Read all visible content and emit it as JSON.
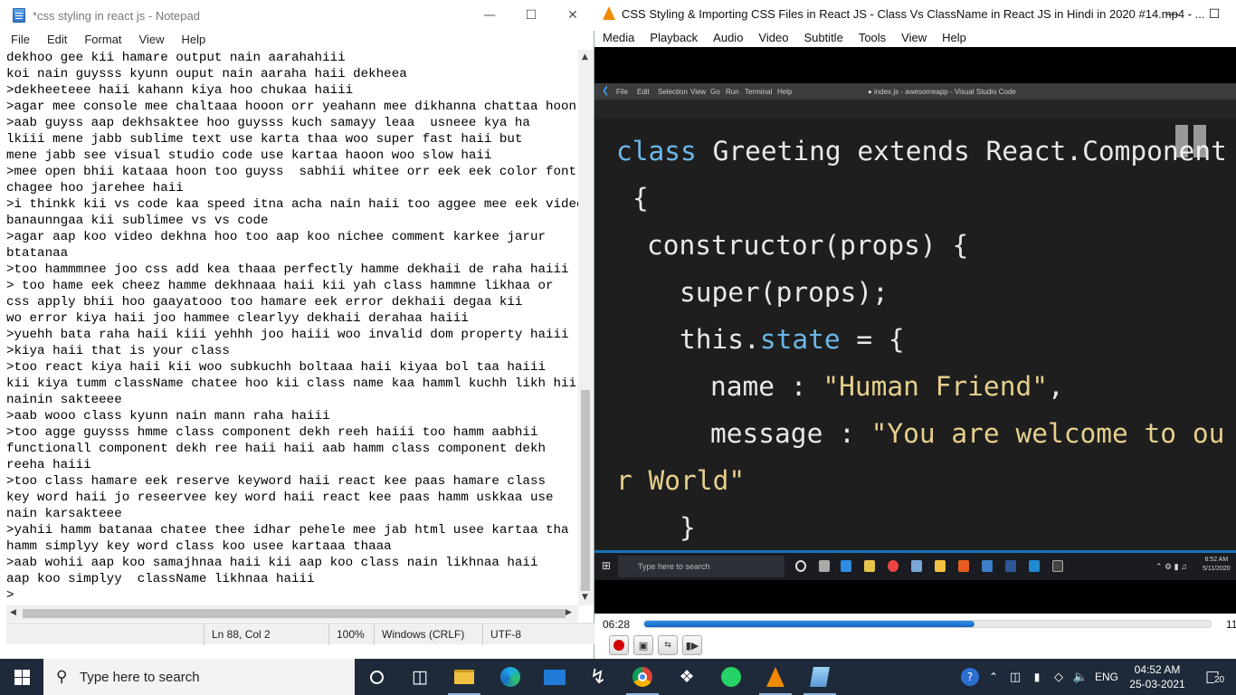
{
  "notepad": {
    "title": "*css styling in react js - Notepad",
    "menu": [
      "File",
      "Edit",
      "Format",
      "View",
      "Help"
    ],
    "lines": [
      "dekhoo gee kii hamare output nain aarahahiii",
      "koi nain guysss kyunn ouput nain aaraha haii dekheea",
      ">dekheeteee haii kahann kiya hoo chukaa haiii",
      ">agar mee console mee chaltaaa hooon orr yeahann mee dikhanna chattaa hoon",
      ">aab guyss aap dekhsaktee hoo guysss kuch samayy leaa  usneee kya ha",
      "lkiii mene jabb sublime text use karta thaa woo super fast haii but",
      "mene jabb see visual studio code use kartaa haoon woo slow haii",
      ">mee open bhii kataaa hoon too guyss  sabhii whitee orr eek eek color font",
      "chagee hoo jarehee haii",
      ">i thinkk kii vs code kaa speed itna acha nain haii too aggee mee eek video",
      "banaunngaa kii sublimee vs vs code",
      ">agar aap koo video dekhna hoo too aap koo nichee comment karkee jarur",
      "btatanaa",
      ">too hammmnee joo css add kea thaaa perfectly hamme dekhaii de raha haiii",
      "> too hame eek cheez hamme dekhnaaa haii kii yah class hammne likhaa or",
      "css apply bhii hoo gaayatooo too hamare eek error dekhaii degaa kii",
      "wo error kiya haii joo hammee clearlyy dekhaii derahaa haiii",
      ">yuehh bata raha haii kiii yehhh joo haiii woo invalid dom property haiii",
      ">kiya haii that is your class",
      ">too react kiya haii kii woo subkuchh boltaaa haii kiyaa bol taa haiii",
      "kii kiya tumm className chatee hoo kii class name kaa hamml kuchh likh hii",
      "nainin sakteeee",
      ">aab wooo class kyunn nain mann raha haiii",
      ">too agge guysss hmme class component dekh reeh haiii too hamm aabhii",
      "functionall component dekh ree haii haii aab hamm class component dekh",
      "reeha haiii",
      ">too class hamare eek reserve keyword haii react kee paas hamare class",
      "key word haii jo reseervee key word haii react kee paas hamm uskkaa use",
      "nain karsakteee",
      ">yahii hamm batanaa chatee thee idhar pehele mee jab html usee kartaa tha",
      "hamm simplyy key word class koo usee kartaaa thaaa",
      ">aab wohii aap koo samajhnaa haii kii aap koo class nain likhnaa haii",
      "aap koo simplyy  className likhnaa haiii",
      ">"
    ],
    "status": {
      "position": "Ln 88, Col 2",
      "zoom": "100%",
      "line_ending": "Windows (CRLF)",
      "encoding": "UTF-8"
    }
  },
  "vlc": {
    "title": "CSS Styling & Importing CSS Files in React JS - Class Vs ClassName in React JS in Hindi in 2020 #14.mp4 - ...",
    "menu": [
      "Media",
      "Playback",
      "Audio",
      "Video",
      "Subtitle",
      "Tools",
      "View",
      "Help"
    ],
    "elapsed": "06:28",
    "remaining": "11",
    "progress": 0.583,
    "video_frame": {
      "vscode_menu": [
        "File",
        "Edit",
        "Selection",
        "View",
        "Go",
        "Run",
        "Terminal",
        "Help"
      ],
      "vscode_title": "● index.js - awesomeapp - Visual Studio Code",
      "code": {
        "line1_kw": "class",
        "line1_rest": " Greeting extends React.Component",
        "line2": "{",
        "line3": "constructor(props) {",
        "line4": "super(props);",
        "line5_a": "this.",
        "line5_kw": "state",
        "line5_b": " = {",
        "line6_a": "name : ",
        "line6_str": "\"Human Friend\"",
        "line6_b": ",",
        "line7_a": "message : ",
        "line7_str": "\"You are welcome to ou",
        "line8_str": "r World\"",
        "line9": "}"
      },
      "taskbar_search": "Type here to search",
      "clock_time": "6:52 AM",
      "clock_date": "5/11/2020"
    }
  },
  "taskbar": {
    "search_placeholder": "Type here to search",
    "language": "ENG",
    "time": "04:52 AM",
    "date": "25-03-2021",
    "notification_count": "20"
  }
}
